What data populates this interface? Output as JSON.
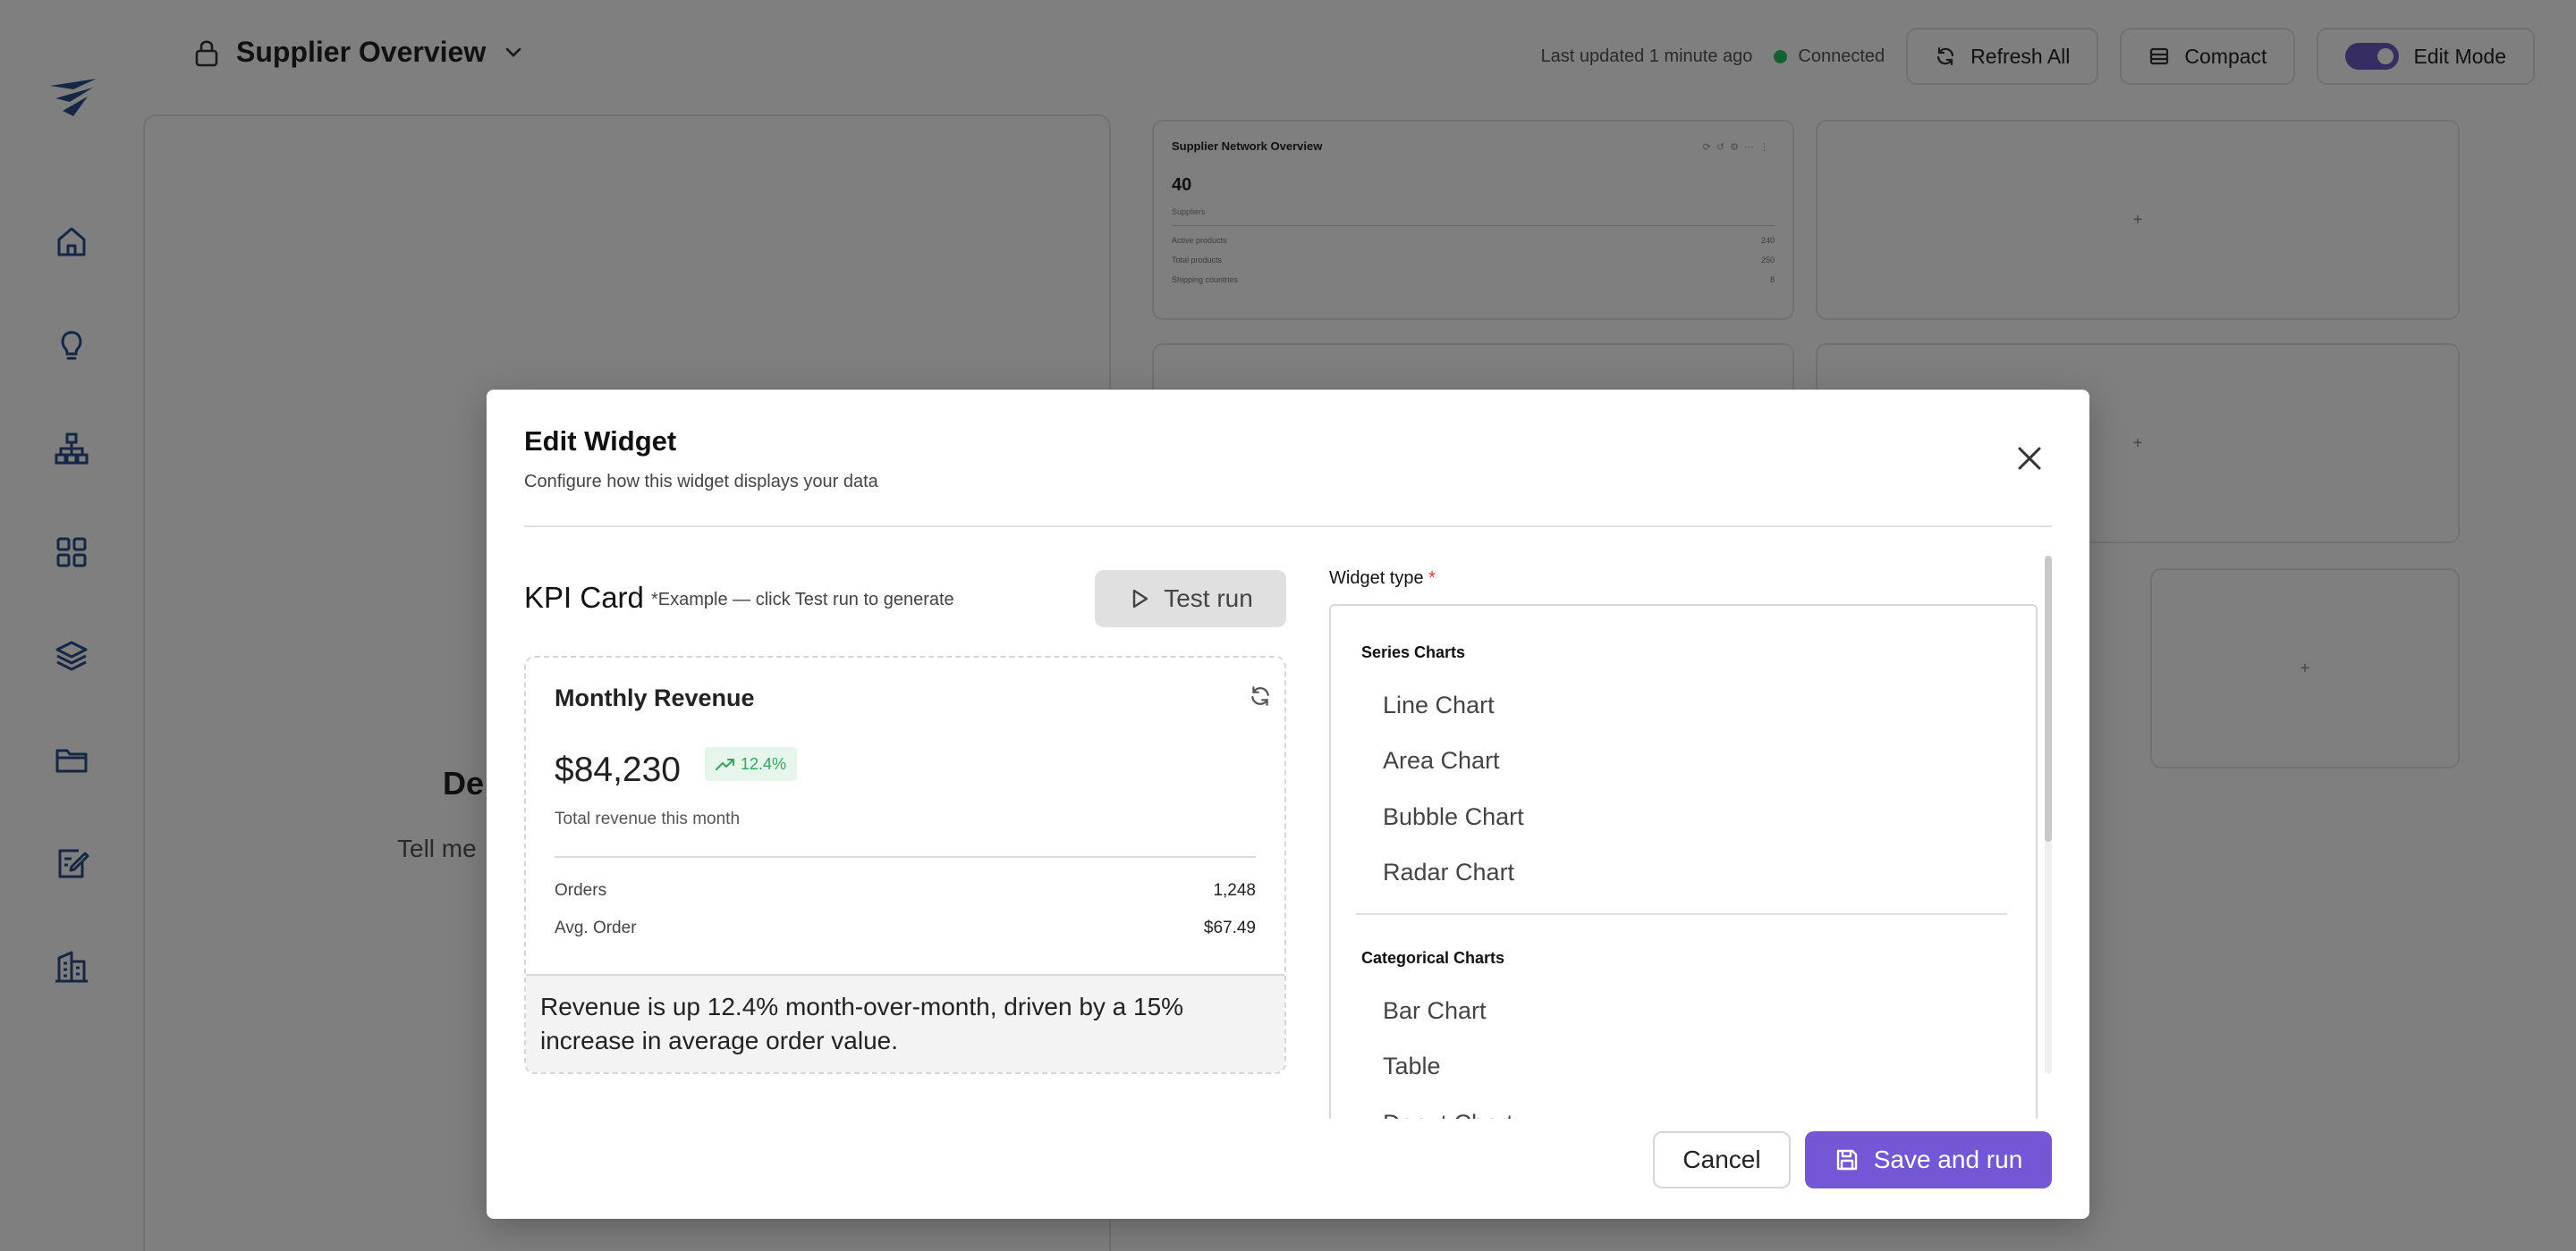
{
  "header": {
    "dashboard_name": "Supplier Overview",
    "last_updated": "Last updated 1 minute ago",
    "connection_status": "Connected",
    "refresh_label": "Refresh All",
    "compact_label": "Compact",
    "edit_mode_label": "Edit Mode",
    "edit_mode_on": true
  },
  "sidebar": {
    "icons": [
      "home-icon",
      "lightbulb-icon",
      "hierarchy-icon",
      "dashboard-grid-icon",
      "layers-icon",
      "folder-icon",
      "edit-note-icon",
      "building-icon"
    ]
  },
  "left_panel": {
    "heading": "De",
    "subtext": "Tell me"
  },
  "mini_widget": {
    "title": "Supplier Network Overview",
    "value": "40",
    "value_caption": "Suppliers",
    "rows": [
      {
        "label": "Active products",
        "value": "240"
      },
      {
        "label": "Total products",
        "value": "250"
      },
      {
        "label": "Shipping countries",
        "value": "8"
      }
    ]
  },
  "modal": {
    "title": "Edit Widget",
    "subtitle": "Configure how this widget displays your data",
    "widget_kind": "KPI Card",
    "example_note": "*Example — click Test run to generate",
    "test_run_label": "Test run",
    "preview": {
      "title": "Monthly Revenue",
      "value": "$84,230",
      "change": "12.4%",
      "caption": "Total revenue this month",
      "rows": [
        {
          "label": "Orders",
          "value": "1,248"
        },
        {
          "label": "Avg. Order",
          "value": "$67.49"
        }
      ],
      "insight": "Revenue is up 12.4% month-over-month, driven by a 15% increase in average order value."
    },
    "widget_type_label": "Widget type",
    "required_mark": "*",
    "groups": [
      {
        "name": "Series Charts",
        "options": [
          "Line Chart",
          "Area Chart",
          "Bubble Chart",
          "Radar Chart"
        ]
      },
      {
        "name": "Categorical Charts",
        "options": [
          "Bar Chart",
          "Table",
          "Donut Chart"
        ]
      }
    ],
    "cancel_label": "Cancel",
    "save_label": "Save and run"
  },
  "colors": {
    "accent": "#7357d4",
    "toggle": "#6d5ac6",
    "connected": "#22c55e",
    "positive": "#2ea85a",
    "required": "#e53935"
  }
}
